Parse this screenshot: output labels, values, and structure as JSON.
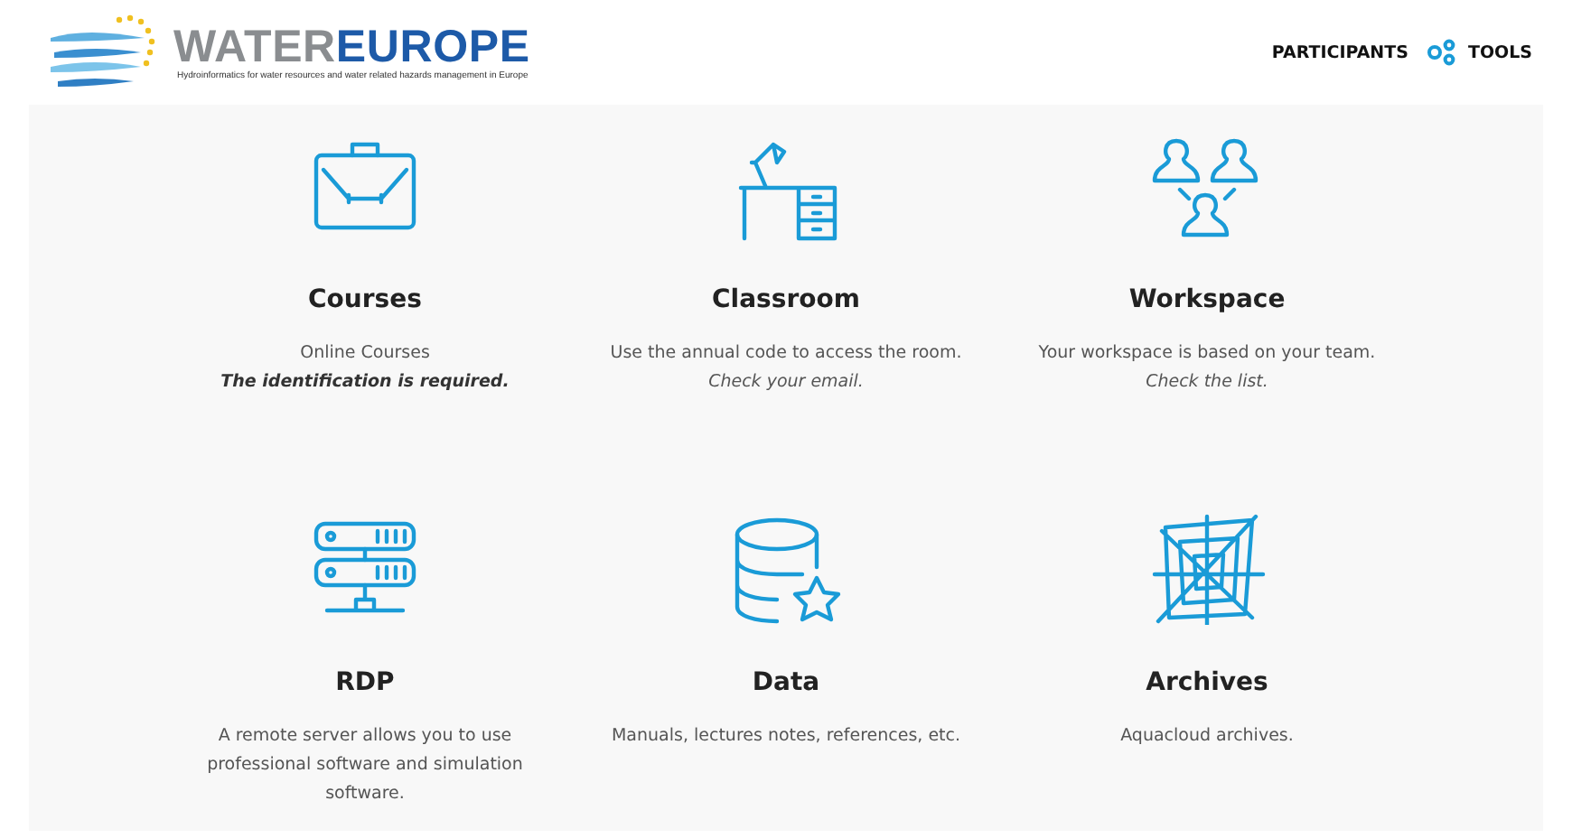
{
  "logo": {
    "word_1": "WATER",
    "word_2": "EUROPE",
    "tagline": "Hydroinformatics for water resources and water related hazards management in Europe"
  },
  "nav": [
    {
      "label": "PARTICIPANTS",
      "icon": false
    },
    {
      "label": "TOOLS",
      "icon": true
    }
  ],
  "tiles": [
    {
      "title": "Courses",
      "lines": [
        {
          "text": "Online Courses",
          "kind": "plain"
        },
        {
          "text": "The identification is required.",
          "kind": "bold-italic"
        }
      ]
    },
    {
      "title": "Classroom",
      "lines": [
        {
          "text": "Use the annual code to access the room.",
          "kind": "plain"
        },
        {
          "text": "Check your email.",
          "kind": "italic"
        }
      ]
    },
    {
      "title": "Workspace",
      "lines": [
        {
          "text": "Your workspace is based on your team.",
          "kind": "plain"
        },
        {
          "text": "Check the list.",
          "kind": "italic"
        }
      ]
    },
    {
      "title": "RDP",
      "lines": [
        {
          "text": "A remote server allows you to use professional software and simulation software.",
          "kind": "plain"
        }
      ]
    },
    {
      "title": "Data",
      "lines": [
        {
          "text": "Manuals, lectures notes, references, etc.",
          "kind": "plain"
        }
      ]
    },
    {
      "title": "Archives",
      "lines": [
        {
          "text": "Aquacloud archives.",
          "kind": "plain"
        }
      ]
    }
  ]
}
